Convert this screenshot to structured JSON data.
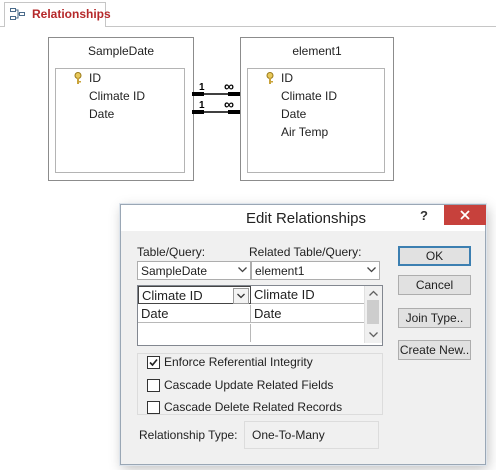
{
  "tab": {
    "label": "Relationships",
    "icon": "relationships-icon",
    "label_color": "#b5282a"
  },
  "tables": [
    {
      "title": "SampleDate",
      "fields": [
        {
          "name": "ID",
          "primary_key": true
        },
        {
          "name": "Climate ID",
          "primary_key": false
        },
        {
          "name": "Date",
          "primary_key": false
        }
      ]
    },
    {
      "title": "element1",
      "fields": [
        {
          "name": "ID",
          "primary_key": true
        },
        {
          "name": "Climate ID",
          "primary_key": false
        },
        {
          "name": "Date",
          "primary_key": false
        },
        {
          "name": "Air Temp",
          "primary_key": false
        }
      ]
    }
  ],
  "relationships": [
    {
      "left_label": "1",
      "right_label": "∞"
    },
    {
      "left_label": "1",
      "right_label": "∞"
    }
  ],
  "dialog": {
    "title": "Edit Relationships",
    "help_label": "?",
    "table_query_label": "Table/Query:",
    "related_table_query_label": "Related Table/Query:",
    "table_query_value": "SampleDate",
    "related_table_query_value": "element1",
    "grid_rows": [
      {
        "left": "Climate ID",
        "right": "Climate ID"
      },
      {
        "left": "Date",
        "right": "Date"
      },
      {
        "left": "",
        "right": ""
      }
    ],
    "options": [
      {
        "label": "Enforce Referential Integrity",
        "checked": true
      },
      {
        "label": "Cascade Update Related Fields",
        "checked": false
      },
      {
        "label": "Cascade Delete Related Records",
        "checked": false
      }
    ],
    "relationship_type_label": "Relationship Type:",
    "relationship_type_value": "One-To-Many",
    "buttons": {
      "ok": "OK",
      "cancel": "Cancel",
      "join_type": "Join Type..",
      "create_new": "Create New.."
    },
    "close_color": "#c7413c"
  }
}
